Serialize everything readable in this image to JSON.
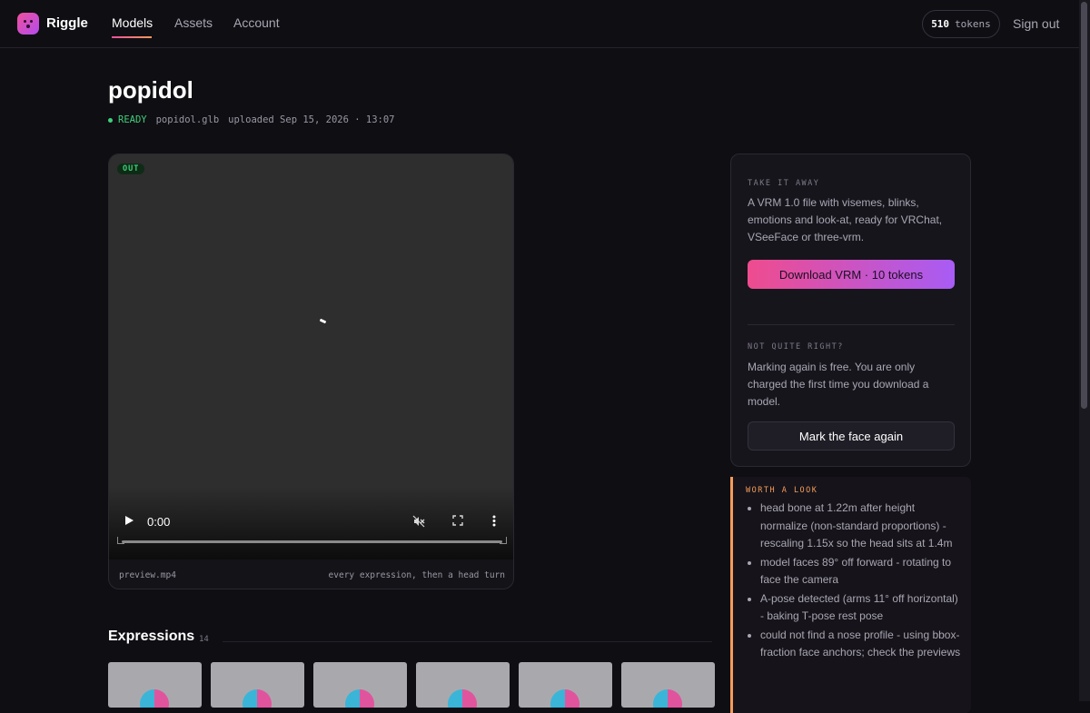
{
  "app": {
    "brand": "Riggle"
  },
  "nav": {
    "models": "Models",
    "assets": "Assets",
    "account": "Account"
  },
  "account": {
    "tokens_value": "510",
    "tokens_label": "tokens",
    "sign_out": "Sign out"
  },
  "model": {
    "title": "popidol",
    "status": "READY",
    "filename": "popidol.glb",
    "uploaded": "uploaded Sep 15, 2026 · 13:07"
  },
  "player": {
    "badge": "OUT",
    "time": "0:00",
    "file": "preview.mp4",
    "caption": "every expression, then a head turn"
  },
  "export": {
    "label": "TAKE IT AWAY",
    "text": "A VRM 1.0 file with visemes, blinks, emotions and look-at, ready for VRChat, VSeeFace or three-vrm.",
    "download_button": "Download VRM · 10 tokens",
    "retry_label": "NOT QUITE RIGHT?",
    "retry_text": "Marking again is free. You are only charged the first time you download a model.",
    "mark_button": "Mark the face again"
  },
  "notes": {
    "label": "WORTH A LOOK",
    "items": [
      "head bone at 1.22m after height normalize (non-standard proportions) - rescaling 1.15x so the head sits at 1.4m",
      "model faces 89° off forward - rotating to face the camera",
      "A-pose detected (arms 11° off horizontal) - baking T-pose rest pose",
      "could not find a nose profile - using bbox-fraction face anchors; check the previews"
    ]
  },
  "expressions": {
    "title": "Expressions",
    "count": "14"
  },
  "colors": {
    "accent_pink": "#ef4c8e",
    "accent_purple": "#a85cf5",
    "ready_green": "#3fd07a",
    "warn_orange": "#f59b5b"
  }
}
